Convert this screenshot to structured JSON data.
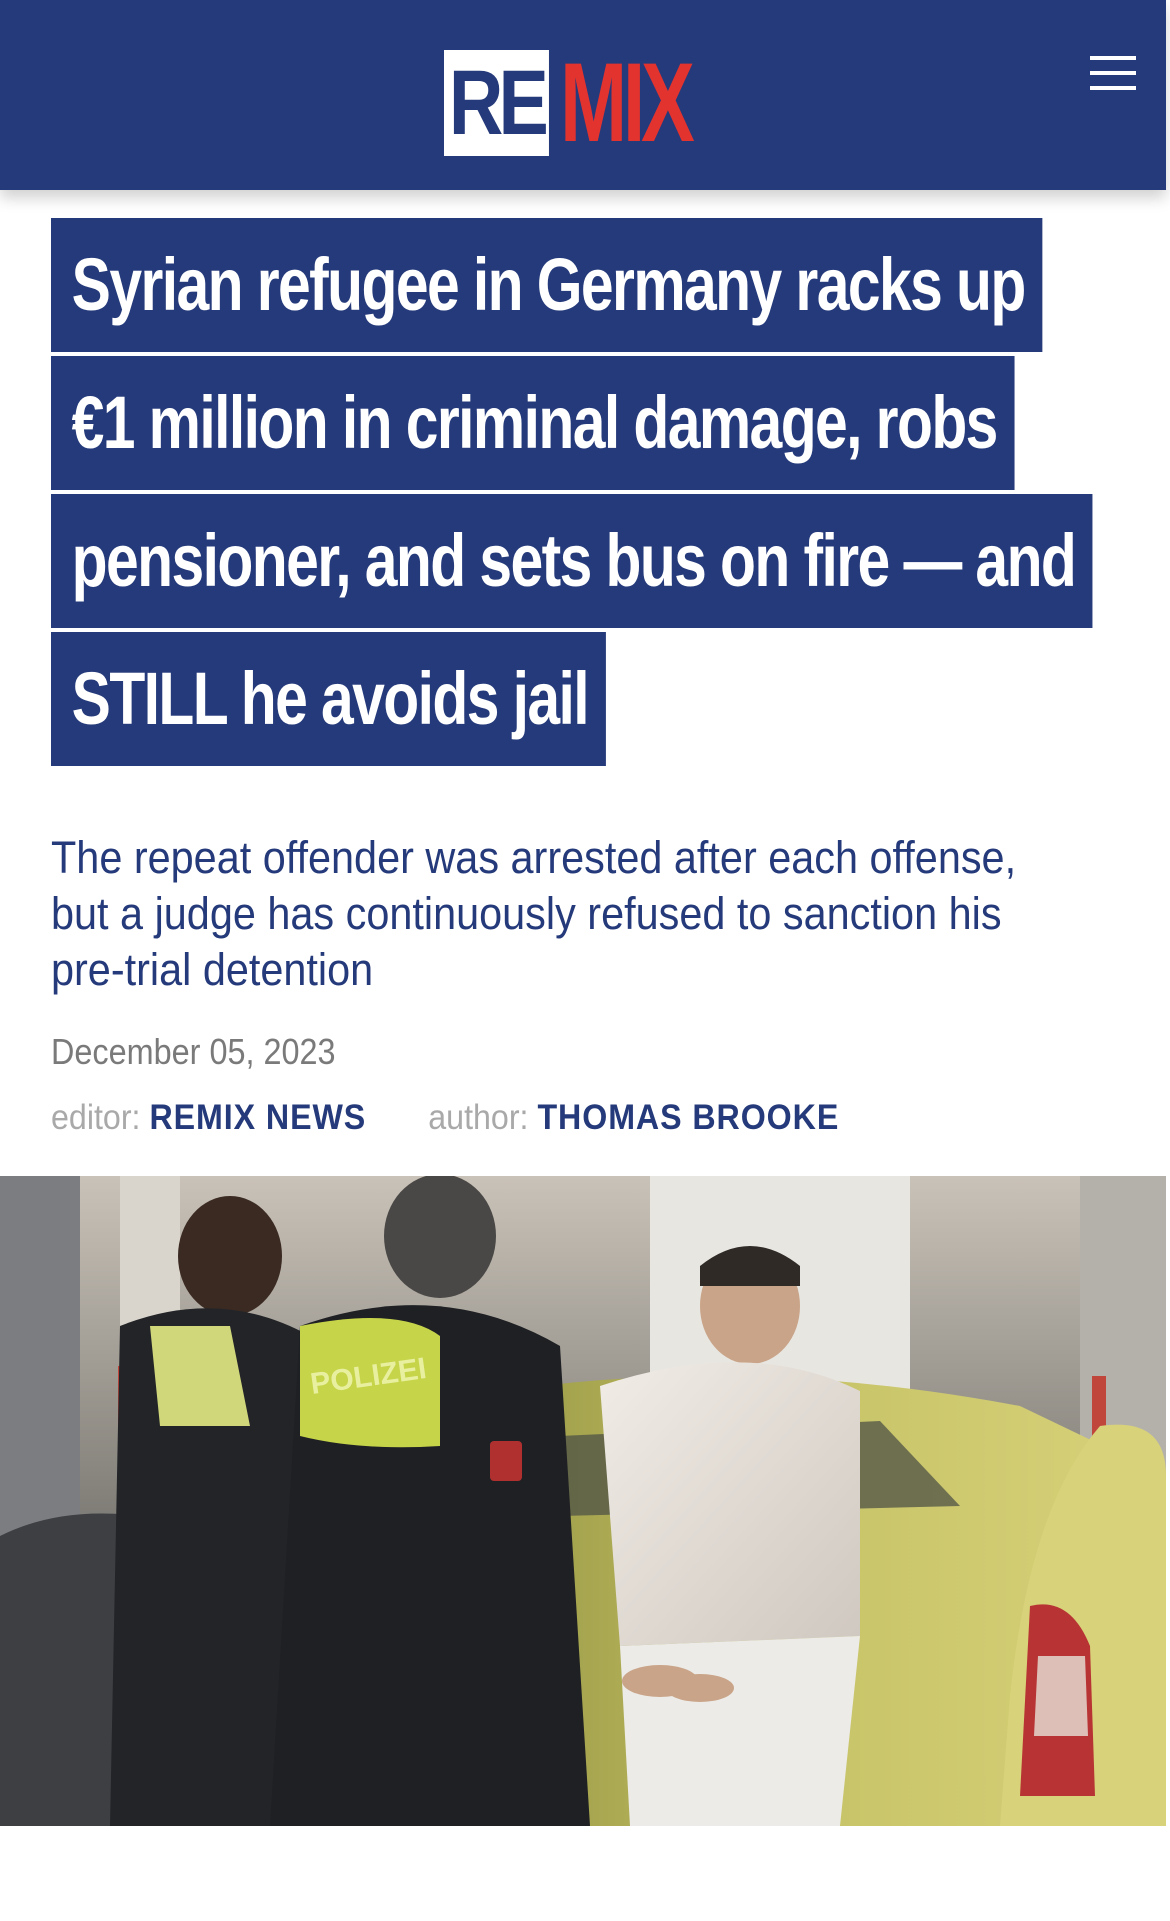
{
  "header": {
    "logo_part1": "RE",
    "logo_part2": "MIX",
    "menu_icon": "hamburger-menu-icon",
    "background_color": "#253a7a",
    "logo_accent_color": "#e2332f"
  },
  "article": {
    "headline_lines": [
      "Syrian refugee in Germany racks up",
      "€1 million in criminal damage, robs",
      "pensioner, and sets bus on fire — and",
      "STILL he avoids jail"
    ],
    "subtitle": "The repeat offender was arrested after each offense, but a judge has continuously refused to sanction his pre-trial detention",
    "date": "December 05, 2023",
    "editor_label": "editor:",
    "editor_name": "REMIX NEWS",
    "author_label": "author:",
    "author_name": "THOMAS BROOKE",
    "photo_badge_text": "POLIZEI"
  }
}
